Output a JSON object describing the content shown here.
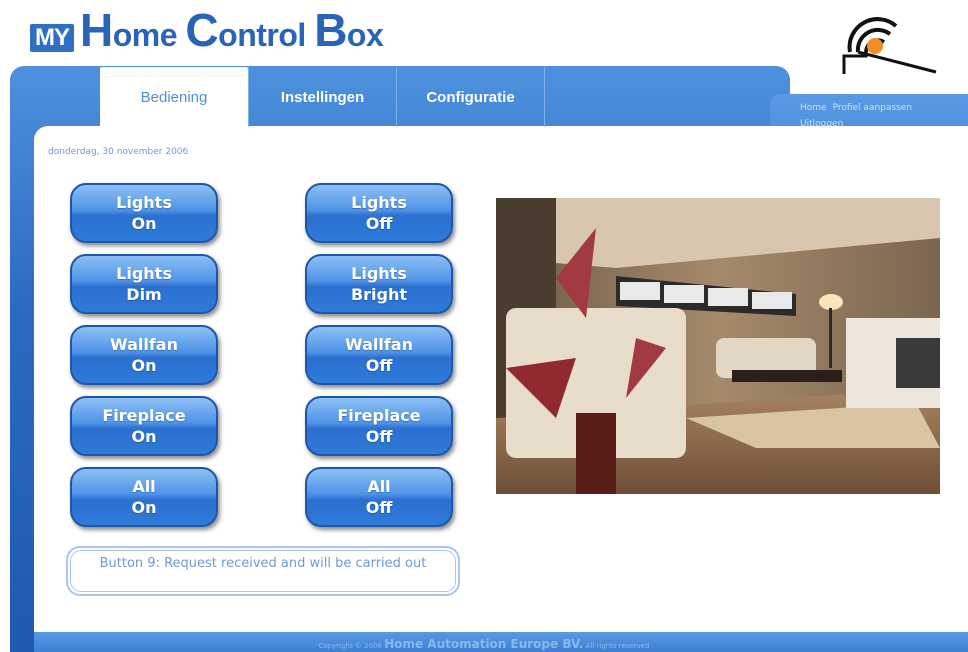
{
  "logo": {
    "my": "MY",
    "h": "H",
    "ome": "ome ",
    "c": "C",
    "ontrol": "ontrol ",
    "b": "B",
    "ox": "ox"
  },
  "tabs": [
    {
      "label": "Bediening",
      "active": true
    },
    {
      "label": "Instellingen",
      "active": false
    },
    {
      "label": "Configuratie",
      "active": false
    }
  ],
  "toplinks": {
    "home": "Home",
    "profile": "Profiel aanpassen",
    "logout": "Uitloggen"
  },
  "date": "donderdag, 30 november 2006",
  "buttons": [
    {
      "line1": "Lights",
      "line2": "On"
    },
    {
      "line1": "Lights",
      "line2": "Off"
    },
    {
      "line1": "Lights",
      "line2": "Dim"
    },
    {
      "line1": "Lights",
      "line2": "Bright"
    },
    {
      "line1": "Wallfan",
      "line2": "On"
    },
    {
      "line1": "Wallfan",
      "line2": "Off"
    },
    {
      "line1": "Fireplace",
      "line2": "On"
    },
    {
      "line1": "Fireplace",
      "line2": "Off"
    },
    {
      "line1": "All",
      "line2": "On"
    },
    {
      "line1": "All",
      "line2": "Off"
    }
  ],
  "status": "Button 9: Request received and will be carried out",
  "footer": {
    "prefix": "Copyright © 2006",
    "company": "Home Automation Europe BV.",
    "suffix": "All rights reserved"
  },
  "colors": {
    "brand_blue": "#2a64b8",
    "frame_blue": "#2c6bc3",
    "button_blue": "#4f93e6",
    "accent_orange": "#f28c28"
  },
  "icons": {
    "brand": "signal-house-icon",
    "photo": "living-room-photo"
  }
}
